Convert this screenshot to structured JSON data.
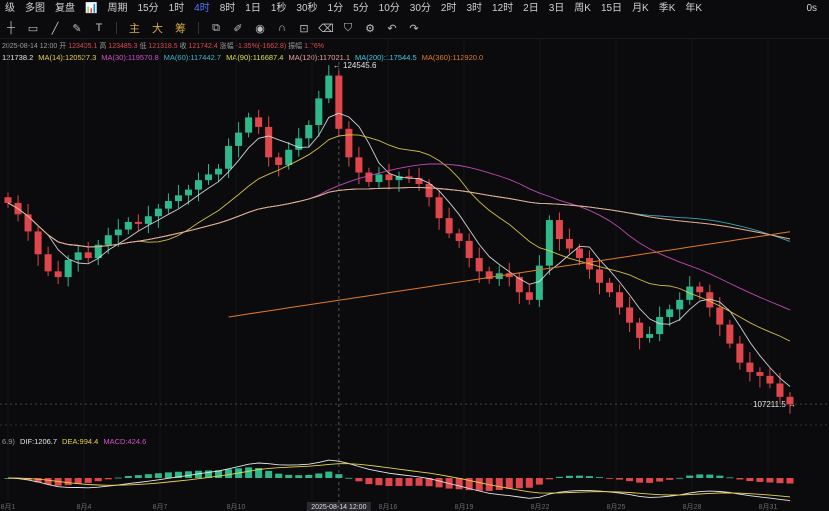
{
  "toolbar": {
    "items": [
      "级",
      "多图",
      "复盘",
      "📊",
      "周期",
      "15分",
      "1时",
      "4时",
      "8时",
      "1日",
      "1秒",
      "30秒",
      "1分",
      "5分",
      "10分",
      "30分",
      "2时",
      "3时",
      "12时",
      "2日",
      "3日",
      "周K",
      "15日",
      "月K",
      "季K",
      "年K"
    ],
    "active": "4时",
    "right": "0s"
  },
  "tools": {
    "labels": [
      "主",
      "大",
      "筹"
    ]
  },
  "info_line": {
    "date": "2025-08-14 12:00",
    "open_label": "开",
    "open": "123405.1",
    "high_label": "高",
    "high": "123485.3",
    "low_label": "低",
    "low": "121318.5",
    "close_label": "收",
    "close": "121742.4",
    "change_label": "涨幅",
    "change": "-1.35%(-1662.8)",
    "amp_label": "振幅",
    "amp": "1.76%"
  },
  "ma_line": [
    {
      "text": "121738.2",
      "color": "#e6e6e6"
    },
    {
      "text": "MA(14):120527.3",
      "color": "#e8d24a"
    },
    {
      "text": "MA(30):119570.8",
      "color": "#d14fc8"
    },
    {
      "text": "MA(60):117442.7",
      "color": "#3fb4c9"
    },
    {
      "text": "MA(90):116687.4",
      "color": "#d9e04a"
    },
    {
      "text": "MA(120):117021.1",
      "color": "#e9a0a0"
    },
    {
      "text": "MA(200):117544.5",
      "color": "#42c9e8"
    },
    {
      "text": "MA(360):112920.0",
      "color": "#e07a2a"
    }
  ],
  "macd_line": [
    {
      "text": "6.9)",
      "color": "#9a9a9a"
    },
    {
      "text": "DIF:1206.7",
      "color": "#e6e6e6"
    },
    {
      "text": "DEA:994.4",
      "color": "#e8d24a"
    },
    {
      "text": "MACD:424.6",
      "color": "#d14fc8"
    }
  ],
  "chart_data": {
    "type": "candlestick",
    "high_label": "124545.6",
    "low_label": "107211.5",
    "x_ticks": [
      "8月1",
      "8月4",
      "8月7",
      "8月10",
      "2025-08-14 12:00",
      "8月16",
      "8月19",
      "8月22",
      "8月25",
      "8月28",
      "8月31"
    ],
    "crosshair_label": "2025-08-14 12:00",
    "closes": [
      117800,
      117200,
      116300,
      115100,
      114200,
      113900,
      114800,
      115200,
      114900,
      115600,
      116100,
      116400,
      116800,
      116700,
      117100,
      117500,
      117900,
      118200,
      118500,
      119000,
      119300,
      119600,
      120800,
      121500,
      122300,
      121800,
      120200,
      119800,
      120600,
      121200,
      121900,
      123300,
      124500,
      121700,
      120200,
      119400,
      118900,
      119300,
      119000,
      119200,
      119100,
      118800,
      118100,
      117000,
      116200,
      115800,
      114900,
      114200,
      113800,
      114100,
      113900,
      113100,
      112700,
      114500,
      116900,
      115900,
      115400,
      114900,
      114300,
      113600,
      113100,
      112300,
      111500,
      110700,
      110900,
      111800,
      112200,
      112700,
      113400,
      113100,
      112300,
      111400,
      110400,
      109400,
      108900,
      108700,
      108300,
      107600,
      107200
    ],
    "colors": {
      "up": "#2fb98a",
      "down": "#e0474c"
    }
  }
}
